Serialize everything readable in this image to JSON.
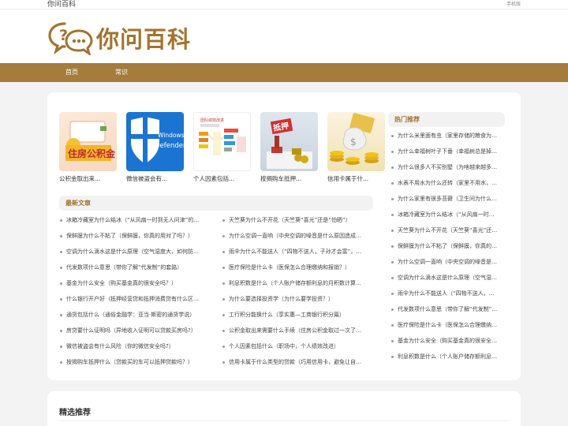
{
  "topbar": {
    "site_name": "你问百科",
    "mobile_link": "手机版"
  },
  "header": {
    "logo_text": "你问百科"
  },
  "nav": {
    "items": [
      "首页",
      "常识"
    ]
  },
  "featured": [
    {
      "caption": "公积金取出来..."
    },
    {
      "caption": "微信被盗会有..."
    },
    {
      "caption": "个人因素包括..."
    },
    {
      "caption": "按揭购车抵押..."
    },
    {
      "caption": "信用卡属于什..."
    }
  ],
  "latest": {
    "title": "最新文章",
    "left": [
      "冰箱冷藏室为什么结冰（“从风扇一时到无人问津”的…",
      "保鲜膜为什么不粘了（保鲜膜，你真的用对了吗？）",
      "空调为什么滴水这是什么原理（空气湿度大，如何防…",
      "代发数项什么意思（带你了解“代发制”的套路）",
      "基金为什么安全（购买基金真的很安全吗？）",
      "什么银行开户好（抵押经营贷和抵押消费贷有什么区…",
      "通货包括什么（通俗金融学：亚当·斯密的通货学说）",
      "房贷要什么证明吗（异地收入证明可以贷款买房吗?）",
      "微信被盗会有什么风险（你的微信安全吗?）",
      "按揭购车抵押什么（贷款买的车可以抵押贷款吗？）"
    ],
    "right": [
      "天竺葵为什么不开花（天竺葵“喜光”还是“怕晒”）",
      "为什么空调一直响（中央空调的噪音是什么原因造成…",
      "雨伞为什么不能送人（“四物不送人，子孙才会富”，…",
      "医疗保险是什么卡（医保怎么合理缴纳和报销？）",
      "利息积数是什么（个人账户储存额利息的月积数计算…",
      "为什么要选择投资学（为什么要学投资？）",
      "工行积分能换什么（享实惠—工商银行积分篇）",
      "公积金取出来需要什么手续（住房公积金取过一次了…",
      "个人因素包括什么（职场中，个人绩效改进）",
      "信用卡属于什么类型的贷款（巧用信用卡，避免让自…"
    ]
  },
  "hot": {
    "title": "热门推荐",
    "items": [
      "为什么米里面有虫（家里存储的粮食为…",
      "为什么幸福树叶子下垂（幸福树总是掉…",
      "为什么很多人不买别墅（为啥越来越多…",
      "水表不用水为什么还转（家里不用水，…",
      "为什么家里有很多苔藓（卫生间为什么…",
      "冰箱冷藏室为什么结冰（“从风扇一时…",
      "天竺葵为什么不开花（天竺葵“喜光”还…",
      "保鲜膜为什么不粘了（保鲜膜，你真的…",
      "为什么空调一直响（中央空调的噪音是…",
      "空调为什么滴水这是什么原理（空气湿…",
      "雨伞为什么不能送人（“四物不送人，…",
      "代发数项什么意思（带你了解“代发制”…",
      "医疗保险是什么卡（医保怎么合理缴纳…",
      "基金为什么安全（购买基金真的很安全…",
      "利息积数是什么（个人账户储存额利息…"
    ]
  },
  "picks": {
    "title": "精选推荐"
  },
  "colors": {
    "brand": "#a4732f",
    "nav_bg": "#a67c3c"
  }
}
